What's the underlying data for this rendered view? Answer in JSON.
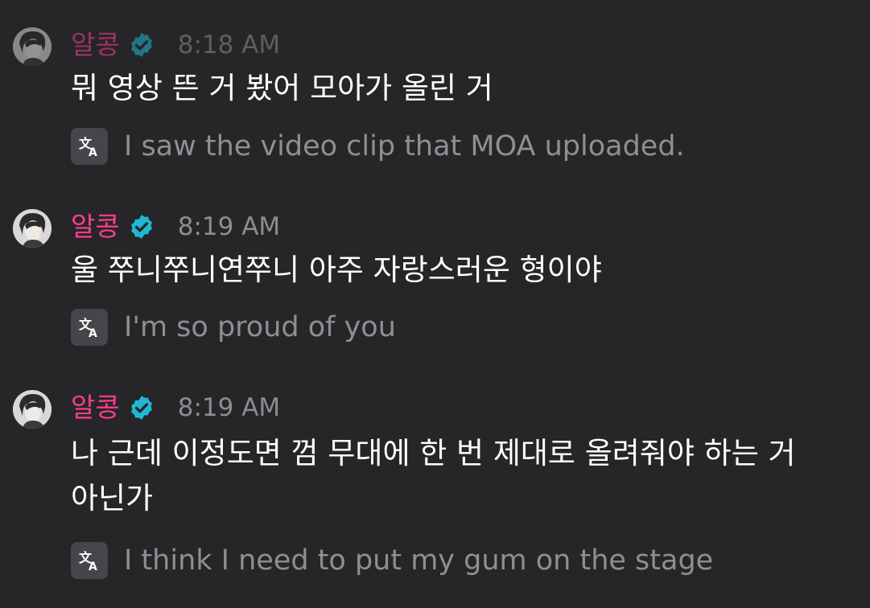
{
  "colors": {
    "background": "#262628",
    "username": "#ff3c8f",
    "verified_badge": "#1fb8d4",
    "timestamp": "#8d8d91",
    "message_text": "#ffffff",
    "translation_text": "#8f8f93",
    "translate_icon_bg": "#46464a"
  },
  "messages": [
    {
      "username": "알콩",
      "verified_icon": "verified-badge-icon",
      "time": "8:18 AM",
      "text": "뭐 영상 뜬 거 봤어 모아가 올린 거",
      "translate_icon": "translate-icon",
      "translation": "I saw the video clip that MOA uploaded."
    },
    {
      "username": "알콩",
      "verified_icon": "verified-badge-icon",
      "time": "8:19 AM",
      "text": "울 쭈니쭈니연쭈니 아주 자랑스러운 형이야",
      "translate_icon": "translate-icon",
      "translation": "I'm so proud of you"
    },
    {
      "username": "알콩",
      "verified_icon": "verified-badge-icon",
      "time": "8:19 AM",
      "text": "나 근데 이정도면 껌 무대에 한 번 제대로 올려줘야 하는 거 아닌가",
      "translate_icon": "translate-icon",
      "translation": "I think I need to put my gum on the stage"
    }
  ]
}
